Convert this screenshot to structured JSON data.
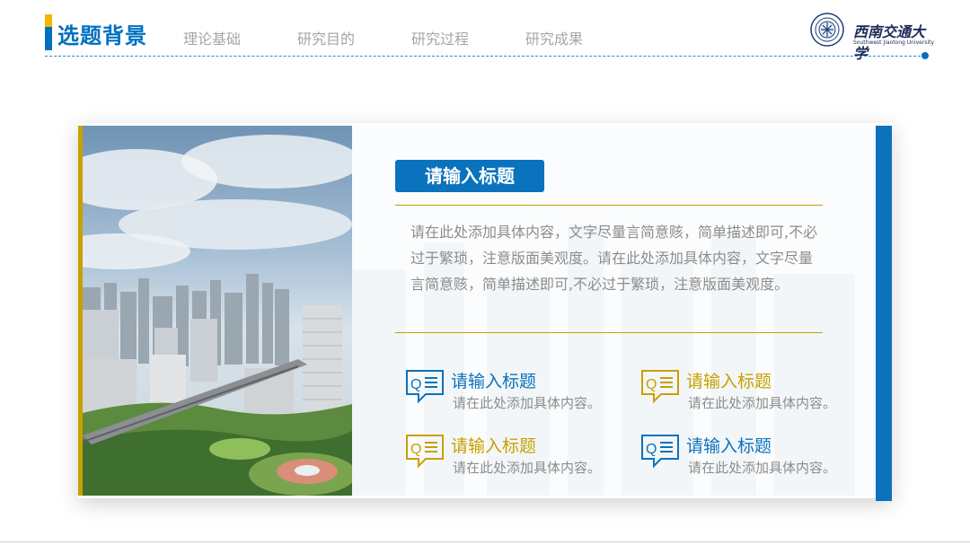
{
  "header": {
    "title": "选题背景",
    "nav": [
      "理论基础",
      "研究目的",
      "研究过程",
      "研究成果"
    ],
    "logo_cn": "西南交通大学",
    "logo_en": "Southwest Jiaotong University"
  },
  "card": {
    "heading": "请输入标题",
    "body": "请在此处添加具体内容，文字尽量言简意赅，简单描述即可,不必过于繁琐，注意版面美观度。请在此处添加具体内容，文字尽量言简意赅，简单描述即可,不必过于繁琐，注意版面美观度。",
    "features": [
      {
        "title": "请输入标题",
        "desc": "请在此处添加具体内容。",
        "icon": "qa-chat-icon",
        "color": "#0b72bd"
      },
      {
        "title": "请输入标题",
        "desc": "请在此处添加具体内容。",
        "icon": "qa-chat-icon",
        "color": "#c8a000"
      },
      {
        "title": "请输入标题",
        "desc": "请在此处添加具体内容。",
        "icon": "qa-chat-icon",
        "color": "#c8a000"
      },
      {
        "title": "请输入标题",
        "desc": "请在此处添加具体内容。",
        "icon": "qa-chat-icon",
        "color": "#0b72bd"
      }
    ]
  },
  "colors": {
    "primary": "#0b72bd",
    "accent": "#c8a000",
    "title": "#0070c0"
  }
}
